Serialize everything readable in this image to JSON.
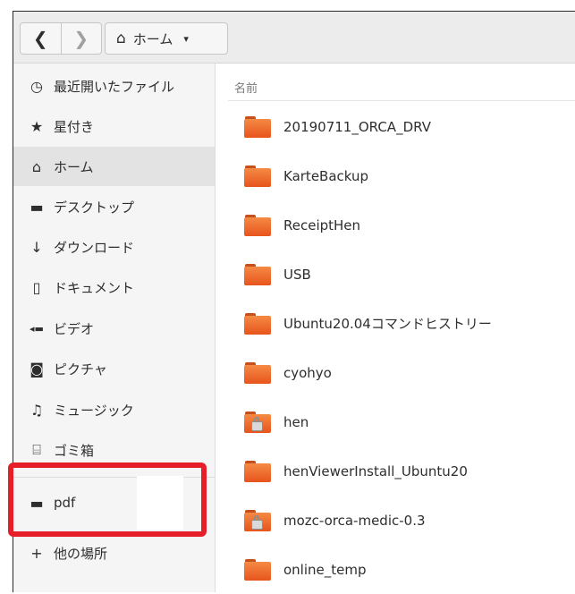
{
  "header": {
    "back_icon": "chevron-left",
    "forward_icon": "chevron-right",
    "path": {
      "icon": "home-icon",
      "label": "ホーム",
      "caret": "▾"
    }
  },
  "sidebar": {
    "items": [
      {
        "icon": "clock-icon",
        "glyph": "◷",
        "label": "最近開いたファイル"
      },
      {
        "icon": "star-icon",
        "glyph": "★",
        "label": "星付き"
      },
      {
        "icon": "home-icon",
        "glyph": "⌂",
        "label": "ホーム",
        "active": true
      },
      {
        "icon": "folder-icon",
        "glyph": "▬",
        "label": "デスクトップ"
      },
      {
        "icon": "download-arrow-icon",
        "glyph": "↓",
        "label": "ダウンロード"
      },
      {
        "icon": "document-icon",
        "glyph": "▯",
        "label": "ドキュメント"
      },
      {
        "icon": "video-camera-icon",
        "glyph": "◂▬",
        "label": "ビデオ"
      },
      {
        "icon": "camera-icon",
        "glyph": "◙",
        "label": "ピクチャ"
      },
      {
        "icon": "music-note-icon",
        "glyph": "♫",
        "label": "ミュージック"
      },
      {
        "icon": "trash-icon",
        "glyph": "⌸",
        "label": "ゴミ箱"
      },
      {
        "icon": "folder-icon",
        "glyph": "▬",
        "label": "pdf"
      },
      {
        "icon": "plus-icon",
        "glyph": "+",
        "label": "他の場所"
      }
    ]
  },
  "filelist": {
    "column_header": "名前",
    "files": [
      {
        "name": "20190711_ORCA_DRV",
        "locked": false
      },
      {
        "name": "KarteBackup",
        "locked": false
      },
      {
        "name": "ReceiptHen",
        "locked": false
      },
      {
        "name": "USB",
        "locked": false
      },
      {
        "name": "Ubuntu20.04コマンドヒストリー",
        "locked": false
      },
      {
        "name": "cyohyo",
        "locked": false
      },
      {
        "name": "hen",
        "locked": true
      },
      {
        "name": "henViewerInstall_Ubuntu20",
        "locked": false
      },
      {
        "name": "mozc-orca-medic-0.3",
        "locked": true
      },
      {
        "name": "online_temp",
        "locked": false
      }
    ]
  },
  "colors": {
    "highlight": "#e61e2a",
    "folder": "#ee6a2c",
    "sidebar_bg": "#f5f5f5"
  }
}
